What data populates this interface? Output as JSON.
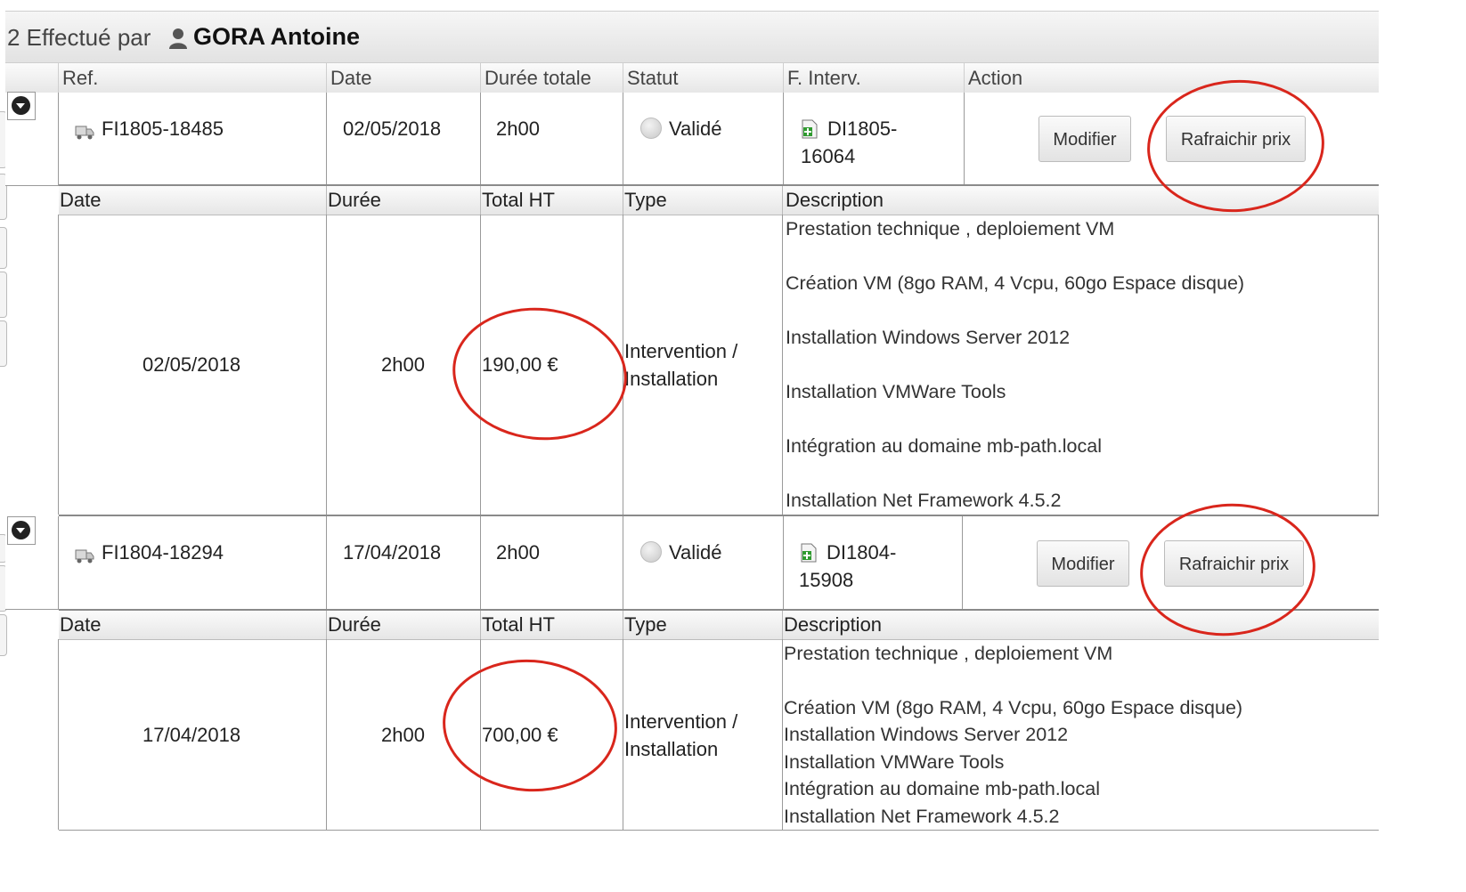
{
  "title": {
    "prefix": "2 Effectué par",
    "name": "GORA Antoine"
  },
  "columns": {
    "ref": "Ref.",
    "date": "Date",
    "duree_totale": "Durée totale",
    "statut": "Statut",
    "f_interv": "F. Interv.",
    "action": "Action"
  },
  "detail_columns": {
    "date": "Date",
    "duree": "Durée",
    "total_ht": "Total HT",
    "type": "Type",
    "description": "Description"
  },
  "interventions": [
    {
      "ref": "FI1805-18485",
      "date": "02/05/2018",
      "duree_totale": "2h00",
      "statut": "Validé",
      "f_interv_line1": "DI1805-",
      "f_interv_line2": "16064",
      "btn_modifier": "Modifier",
      "btn_rafraichir": "Rafraichir prix",
      "detail": {
        "date": "02/05/2018",
        "duree": "2h00",
        "total_ht": "190,00 €",
        "type_line1": "Intervention /",
        "type_line2": "Installation",
        "description": [
          "Prestation technique , deploiement VM",
          "Création VM (8go RAM, 4 Vcpu, 60go Espace disque)",
          "Installation Windows Server 2012",
          "Installation VMWare Tools",
          "Intégration au domaine mb-path.local",
          "Installation Net Framework 4.5.2"
        ]
      }
    },
    {
      "ref": "FI1804-18294",
      "date": "17/04/2018",
      "duree_totale": "2h00",
      "statut": "Validé",
      "f_interv_line1": "DI1804-",
      "f_interv_line2": "15908",
      "btn_modifier": "Modifier",
      "btn_rafraichir": "Rafraichir prix",
      "detail": {
        "date": "17/04/2018",
        "duree": "2h00",
        "total_ht": "700,00 €",
        "type_line1": "Intervention /",
        "type_line2": "Installation",
        "description": [
          "Prestation technique , deploiement VM",
          "Création VM (8go RAM, 4 Vcpu, 60go Espace disque)",
          "Installation Windows Server 2012",
          "Installation VMWare Tools",
          "Intégration au domaine mb-path.local",
          "Installation Net Framework 4.5.2"
        ]
      }
    }
  ],
  "annotation_color": "#d9261c",
  "link_color": "#1a2a6c",
  "icons": {
    "user": "person-icon",
    "toggle": "collapse-toggle-icon",
    "ref": "truck-icon",
    "status": "status-dot-icon",
    "f_interv": "document-add-icon"
  }
}
